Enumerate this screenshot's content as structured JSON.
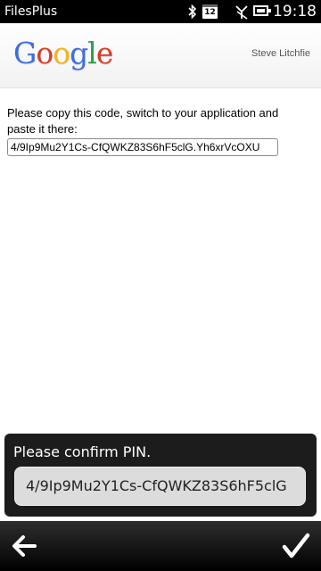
{
  "status_bar": {
    "app_name": "FilesPlus",
    "calendar_day": "12",
    "time": "19:18"
  },
  "header": {
    "logo_letters": [
      "G",
      "o",
      "o",
      "g",
      "l",
      "e"
    ],
    "logo_colors": [
      "#3b6de3",
      "#d93b2b",
      "#f3b51f",
      "#3b6de3",
      "#2e9e49",
      "#d93b2b"
    ],
    "account_name": "Steve Litchfie"
  },
  "content": {
    "instructions": "Please copy this code, switch to your application and paste it there:",
    "code_value": "4/9Ip9Mu2Y1Cs-CfQWKZ83S6hF5clG.Yh6xrVcOXU"
  },
  "dialog": {
    "title": "Please confirm PIN.",
    "pin_value": "4/9Ip9Mu2Y1Cs-CfQWKZ83S6hF5clG"
  },
  "toolbar": {
    "back_icon": "arrow-left-icon",
    "confirm_icon": "checkmark-icon"
  }
}
